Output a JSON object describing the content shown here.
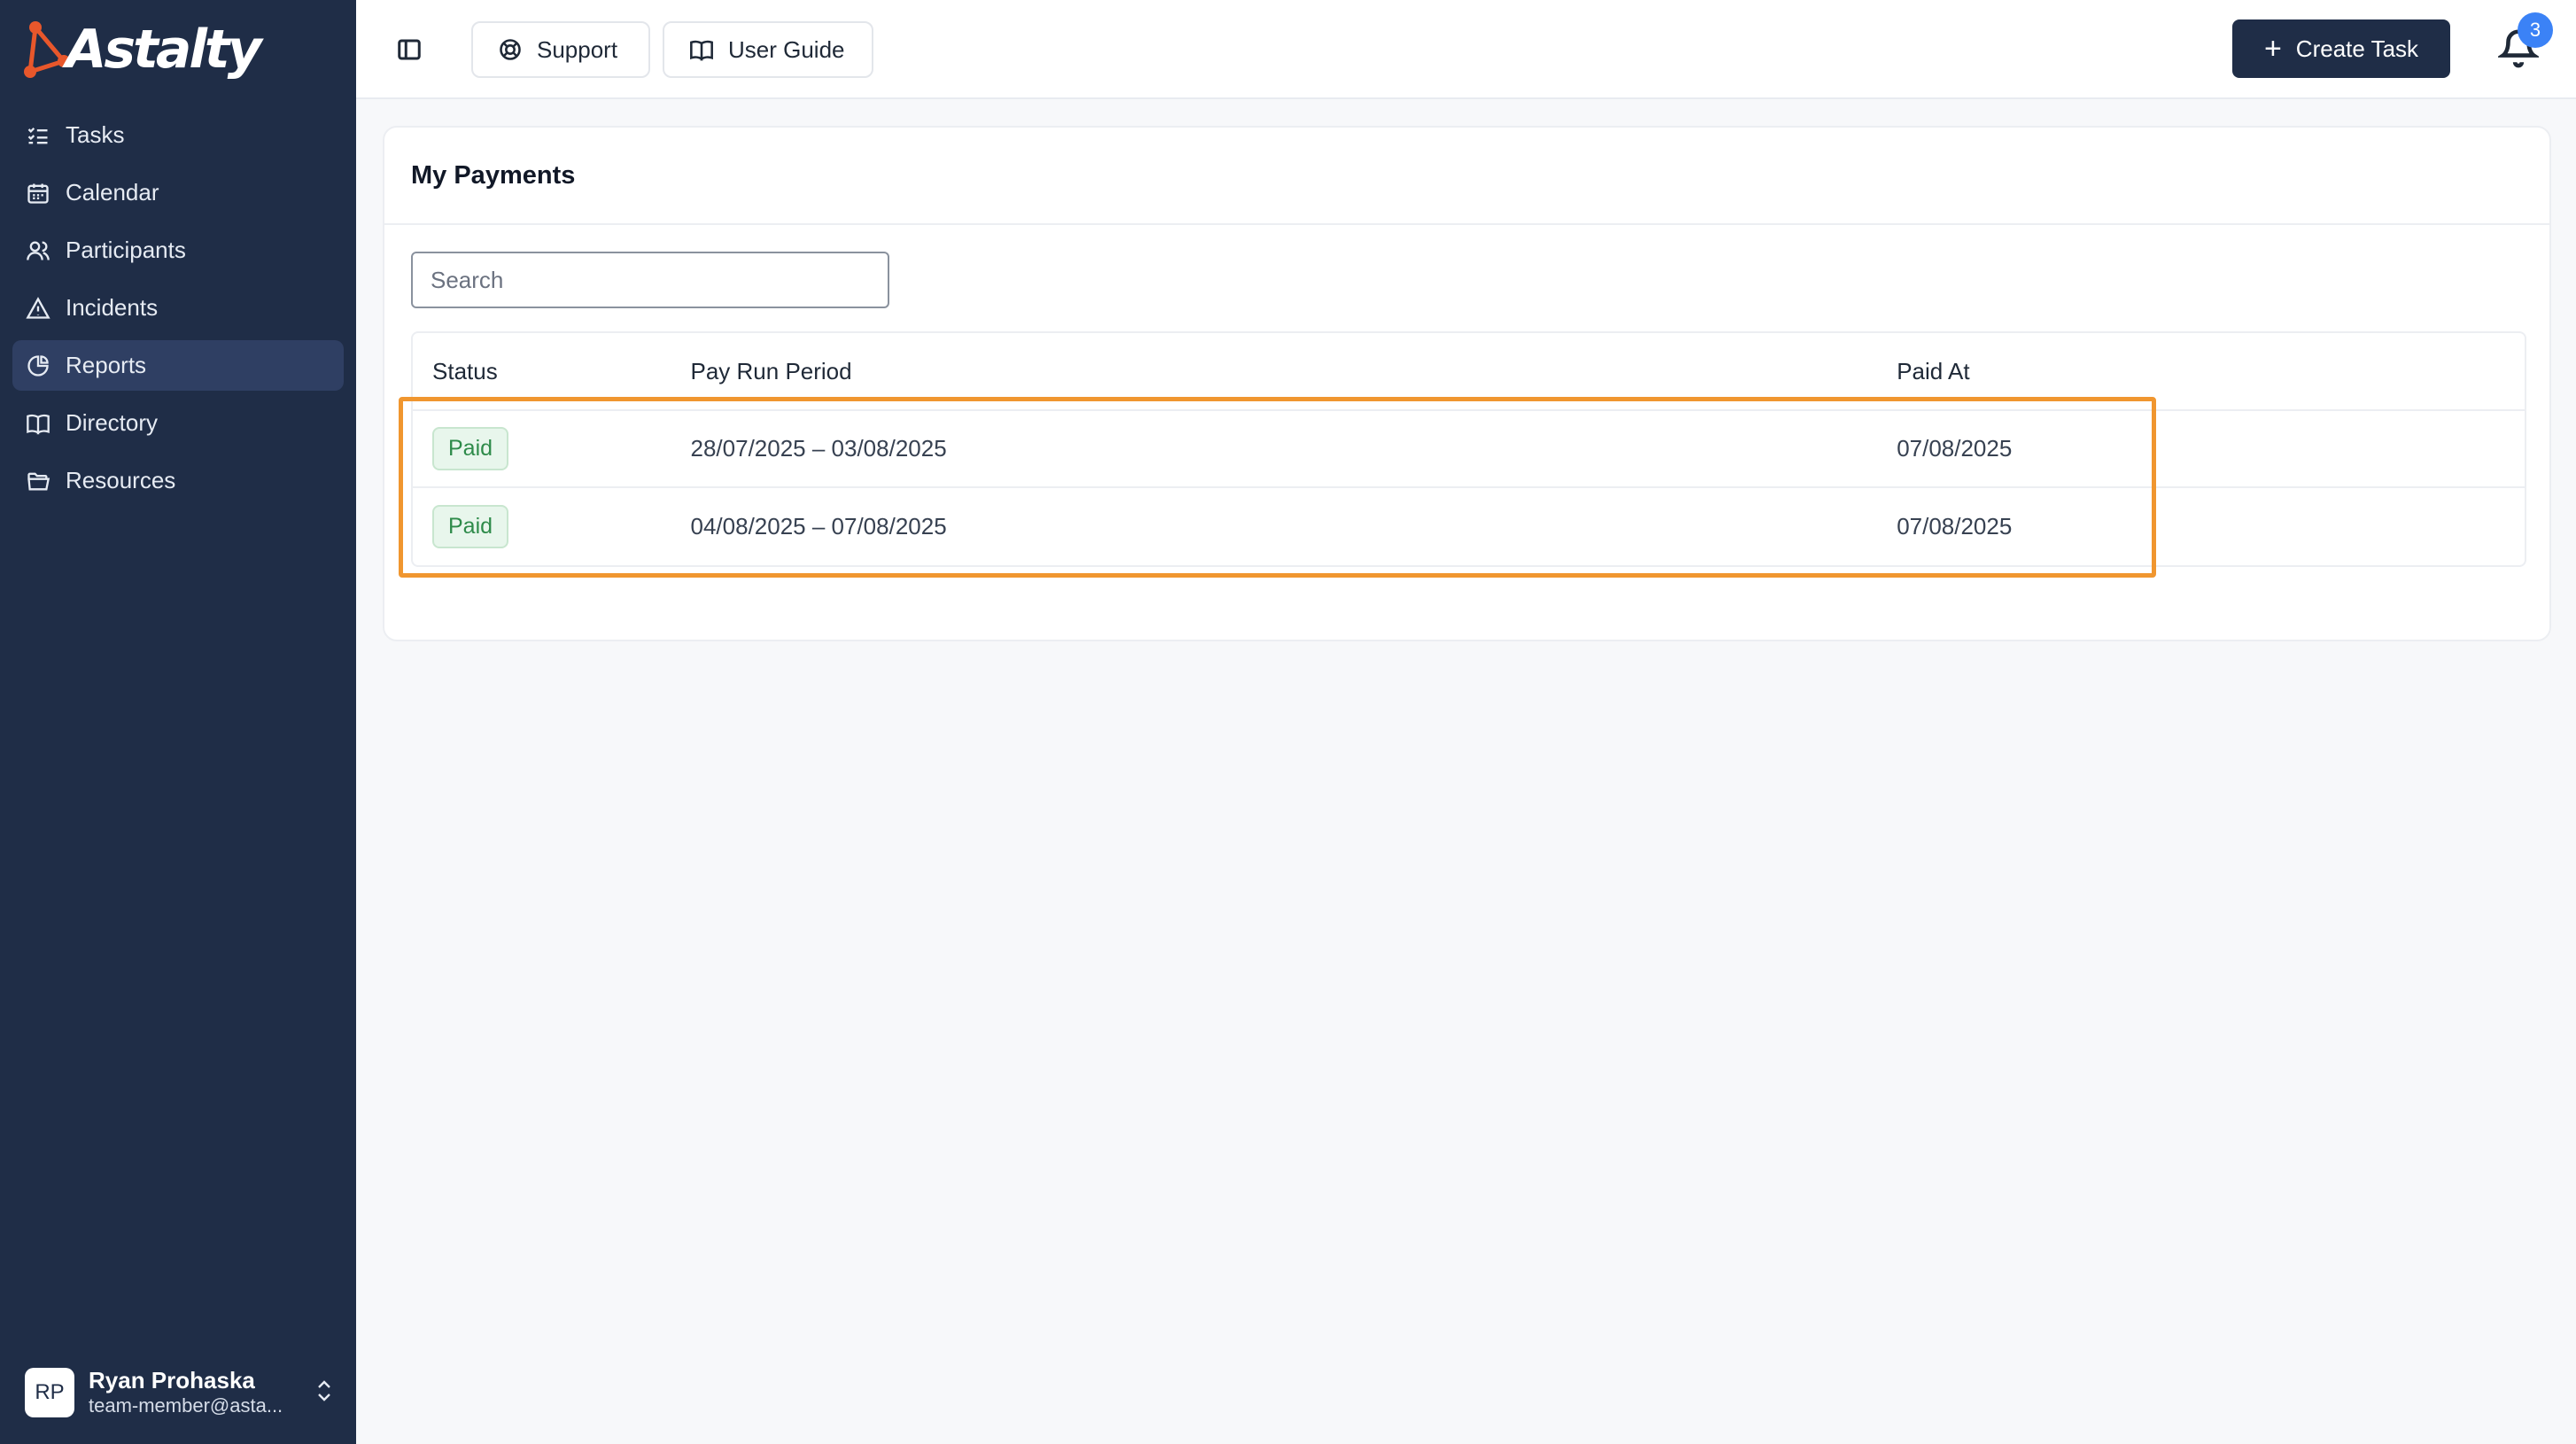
{
  "app": {
    "logo_text": "Astalty"
  },
  "sidebar": {
    "items": [
      {
        "label": "Tasks",
        "icon": "tasks-icon"
      },
      {
        "label": "Calendar",
        "icon": "calendar-icon"
      },
      {
        "label": "Participants",
        "icon": "users-icon"
      },
      {
        "label": "Incidents",
        "icon": "warning-icon"
      },
      {
        "label": "Reports",
        "icon": "pie-chart-icon",
        "active": true
      },
      {
        "label": "Directory",
        "icon": "book-icon"
      },
      {
        "label": "Resources",
        "icon": "folder-icon"
      }
    ],
    "user": {
      "initials": "RP",
      "name": "Ryan Prohaska",
      "email": "team-member@asta..."
    }
  },
  "topbar": {
    "support_label": "Support",
    "guide_label": "User Guide",
    "create_label": "Create Task",
    "notification_count": "3"
  },
  "main": {
    "title": "My Payments",
    "search_placeholder": "Search",
    "columns": [
      "Status",
      "Pay Run Period",
      "Paid At"
    ],
    "rows": [
      {
        "status": "Paid",
        "period": "28/07/2025 – 03/08/2025",
        "paid_at": "07/08/2025"
      },
      {
        "status": "Paid",
        "period": "04/08/2025 – 07/08/2025",
        "paid_at": "07/08/2025"
      }
    ]
  },
  "colors": {
    "sidebar": "#1f2d47",
    "accent_highlight": "#f0962f",
    "paid_badge": "#2e8b4a",
    "notification_badge": "#3b82f6"
  }
}
